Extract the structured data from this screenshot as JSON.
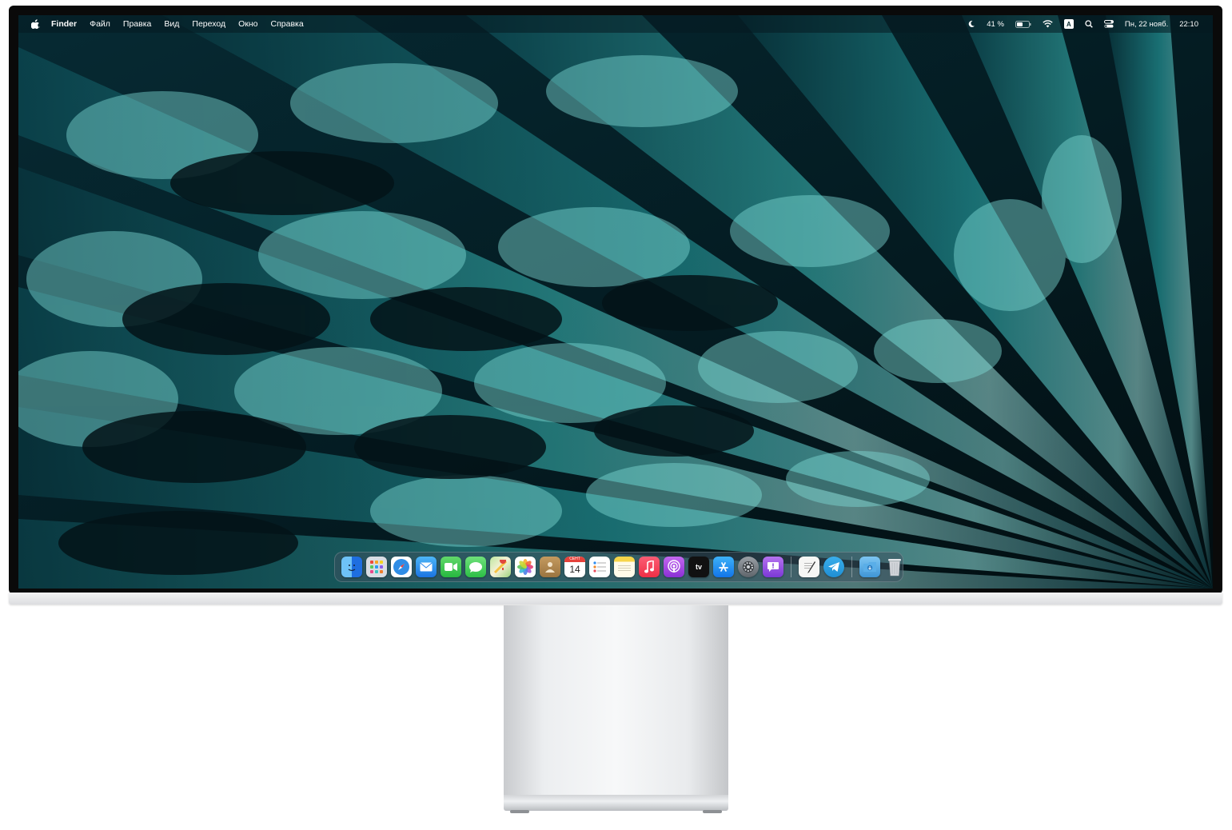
{
  "menubar": {
    "app_name": "Finder",
    "menus": [
      "Файл",
      "Правка",
      "Вид",
      "Переход",
      "Окно",
      "Справка"
    ],
    "battery": "41 %",
    "input_source": "A",
    "date": "Пн, 22 нояб.",
    "time": "22:10"
  },
  "dock": {
    "apps": [
      {
        "name": "finder-icon"
      },
      {
        "name": "launchpad-icon"
      },
      {
        "name": "safari-icon"
      },
      {
        "name": "mail-icon"
      },
      {
        "name": "facetime-icon"
      },
      {
        "name": "messages-icon"
      },
      {
        "name": "maps-icon"
      },
      {
        "name": "photos-icon"
      },
      {
        "name": "contacts-icon"
      },
      {
        "name": "calendar-icon",
        "month": "СЕНТ",
        "day": "14"
      },
      {
        "name": "reminders-icon"
      },
      {
        "name": "notes-icon"
      },
      {
        "name": "music-icon"
      },
      {
        "name": "podcasts-icon"
      },
      {
        "name": "apple-tv-icon",
        "label": "tv"
      },
      {
        "name": "app-store-icon"
      },
      {
        "name": "system-settings-icon"
      },
      {
        "name": "feedback-assistant-icon"
      }
    ],
    "extras": [
      {
        "name": "textedit-icon"
      },
      {
        "name": "telegram-icon"
      },
      {
        "name": "downloads-folder-icon"
      },
      {
        "name": "trash-icon"
      }
    ]
  },
  "colors": {
    "wallpaper_dark": "#03161b",
    "wallpaper_teal": "#3fc6c4",
    "wallpaper_light": "#a9ece8"
  }
}
